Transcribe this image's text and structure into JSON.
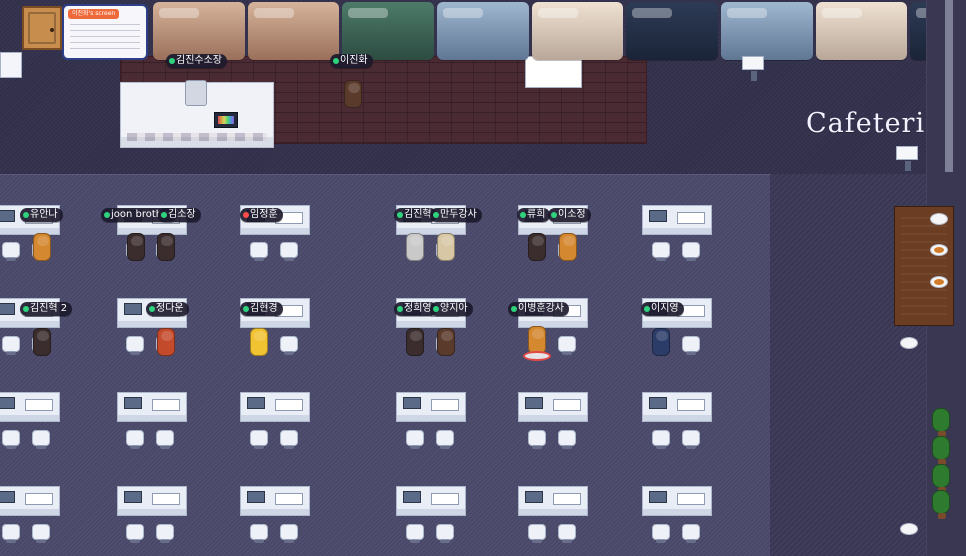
{
  "map": {
    "area_label": "Cafeteria"
  },
  "shared_screen": {
    "title": "이진화's screen"
  },
  "labels": {
    "top": [
      "김진수소장",
      "이진화"
    ],
    "row1": [
      "유안나",
      "joon brother",
      "김소장",
      "임정훈",
      "김진혁",
      "만두강사",
      "류희",
      "이소정"
    ],
    "row2": [
      "김진혁 2",
      "정다운",
      "김현경",
      "정희영",
      "양지아",
      "이병훈강사",
      "이지영"
    ]
  },
  "video_tiles": [
    {
      "style": "warm"
    },
    {
      "style": "warm"
    },
    {
      "style": "green"
    },
    {
      "style": "blue"
    },
    {
      "style": "cream"
    },
    {
      "style": "dark"
    },
    {
      "style": "blue"
    },
    {
      "style": "cream"
    },
    {
      "style": "dark"
    }
  ],
  "colors": {
    "status_online": "#2fd27d",
    "status_busy": "#ff4b4b",
    "selected_ring": "#e04848"
  },
  "icons": {
    "door": "door-icon",
    "shared_screen": "screen-share-icon",
    "plant": "plant-icon",
    "plate": "plate-icon",
    "coffee_machine": "coffee-machine-icon",
    "rainbow_screen": "rainbow-screen-icon"
  }
}
